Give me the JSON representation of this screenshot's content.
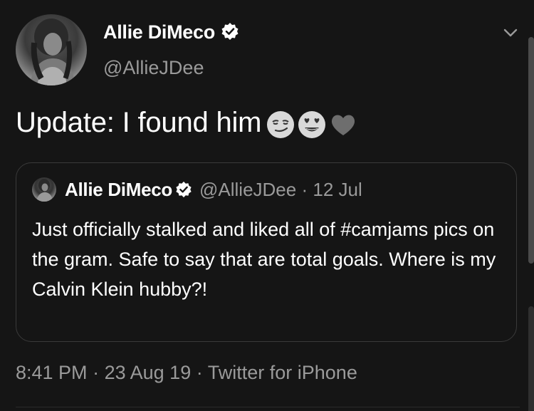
{
  "author": {
    "name": "Allie DiMeco",
    "handle": "@AllieJDee",
    "verified": true
  },
  "tweet": {
    "text": "Update: I found him",
    "emojis": [
      "smirking-face",
      "heart-eyes-face",
      "heart"
    ]
  },
  "quoted_tweet": {
    "name": "Allie DiMeco",
    "handle": "@AllieJDee",
    "separator": "·",
    "date": "12 Jul",
    "text": "Just officially stalked and liked all of #camjams pics on the gram. Safe to say that are total goals. Where is my Calvin Klein hubby?!"
  },
  "meta": {
    "time": "8:41 PM",
    "separator": "·",
    "date": "23 Aug 19",
    "source": "Twitter for iPhone"
  },
  "colors": {
    "background": "#151515",
    "text": "#ffffff",
    "secondary": "#9a9a9a",
    "border": "#3a3a3a"
  }
}
